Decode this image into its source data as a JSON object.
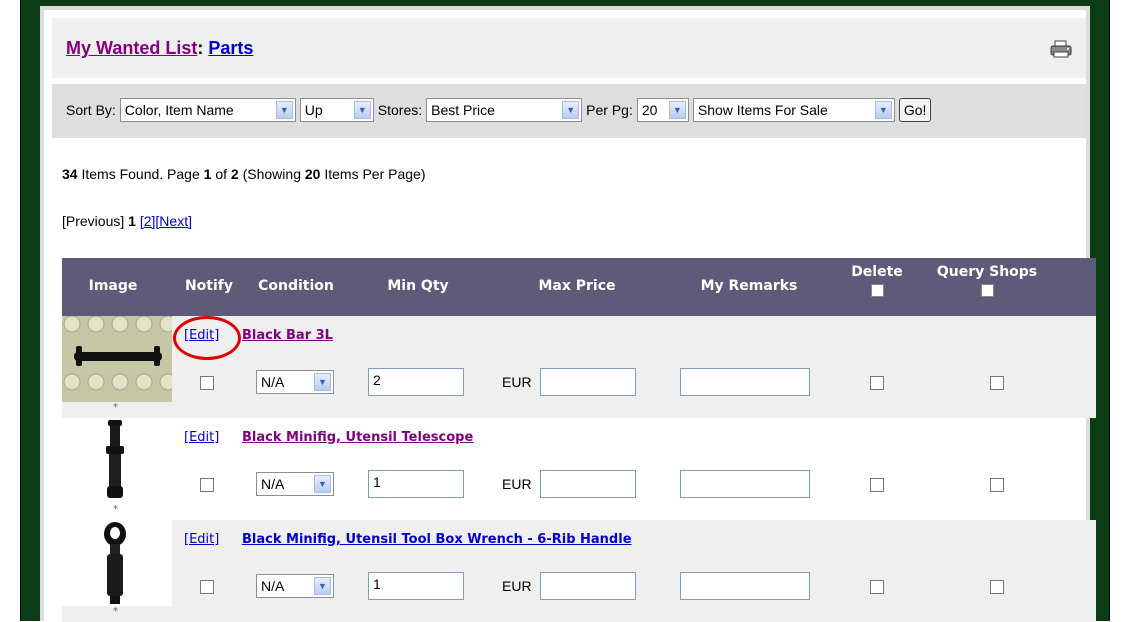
{
  "title": {
    "part1": "My Wanted List",
    "sep": ":",
    "part2": "Parts"
  },
  "sortbar": {
    "sort_label": "Sort By:",
    "sort_value": "Color, Item Name",
    "direction_value": "Up",
    "stores_label": "Stores:",
    "stores_value": "Best Price",
    "perpage_label": "Per Pg:",
    "perpage_value": "20",
    "filter_value": "Show Items For Sale",
    "go_label": "Go!"
  },
  "summary": {
    "count": "34",
    "t1": " Items Found. Page ",
    "page": "1",
    "t2": " of ",
    "pages": "2",
    "t3": " (Showing ",
    "per": "20",
    "t4": " Items Per Page)"
  },
  "pager": {
    "prev": "[Previous]",
    "current": "1",
    "page2": "[2]",
    "next": "[Next]"
  },
  "columns": {
    "image": "Image",
    "notify": "Notify",
    "condition": "Condition",
    "minqty": "Min Qty",
    "maxprice": "Max Price",
    "remarks": "My Remarks",
    "delete": "Delete",
    "query": "Query Shops"
  },
  "items": [
    {
      "edit": "[Edit]",
      "name": "Black Bar 3L",
      "condition": "N/A",
      "qty": "2",
      "currency": "EUR",
      "star": "*"
    },
    {
      "edit": "[Edit]",
      "name": "Black Minifig, Utensil Telescope",
      "condition": "N/A",
      "qty": "1",
      "currency": "EUR",
      "star": "*"
    },
    {
      "edit": "[Edit]",
      "name": "Black Minifig, Utensil Tool Box Wrench - 6-Rib Handle",
      "condition": "N/A",
      "qty": "1",
      "currency": "EUR",
      "star": "*"
    }
  ]
}
